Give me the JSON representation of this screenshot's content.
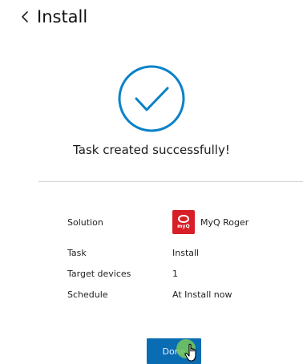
{
  "header": {
    "back_icon": "chevron-left-icon",
    "title": "Install"
  },
  "success": {
    "icon": "check-circle-icon",
    "message": "Task created successfully!",
    "accent": "#0a82c8"
  },
  "summary": {
    "solution": {
      "label": "Solution",
      "logo_icon": "myq-logo-icon",
      "logo_text": "myQ",
      "value": "MyQ Roger",
      "logo_color": "#d61f26"
    },
    "task": {
      "label": "Task",
      "value": "Install"
    },
    "target_devices": {
      "label": "Target devices",
      "value": "1"
    },
    "schedule": {
      "label": "Schedule",
      "value": "At Install now"
    }
  },
  "actions": {
    "done_label": "Done",
    "button_color": "#0a6cb3"
  },
  "cursor": {
    "icon": "hand-pointer-icon",
    "highlight_color": "#78c85a"
  }
}
